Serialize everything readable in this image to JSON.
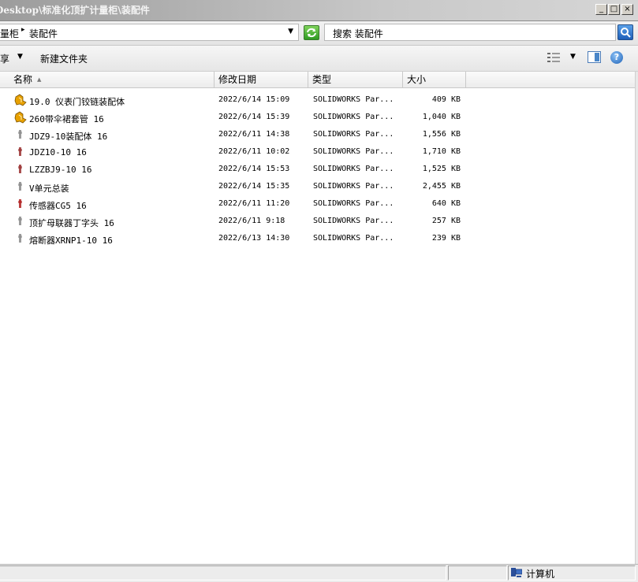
{
  "window": {
    "title": "Desktop\\标准化顶扩计量柜\\装配件",
    "minimize_label": "_",
    "maximize_label": "□",
    "close_label": "×"
  },
  "address": {
    "crumbs": [
      "量柜",
      "装配件"
    ],
    "separator": "▸",
    "dropdown": "▼"
  },
  "search": {
    "placeholder": "搜索 装配件"
  },
  "toolbar": {
    "share_label": "享",
    "share_dropdown": "▼",
    "new_folder_label": "新建文件夹",
    "view_dropdown": "▼",
    "help_label": "?"
  },
  "columns": {
    "name": "名称",
    "date": "修改日期",
    "type": "类型",
    "size": "大小",
    "sort_indicator": "▲"
  },
  "files": [
    {
      "name": "19.0 仪表门铰链装配体",
      "date": "2022/6/14 15:09",
      "type": "SOLIDWORKS Par...",
      "size": "409 KB",
      "icon": "assembly-icon"
    },
    {
      "name": "260带伞裙套管 16",
      "date": "2022/6/14 15:39",
      "type": "SOLIDWORKS Par...",
      "size": "1,040 KB",
      "icon": "assembly-icon"
    },
    {
      "name": "JDZ9-10装配体 16",
      "date": "2022/6/11 14:38",
      "type": "SOLIDWORKS Par...",
      "size": "1,556 KB",
      "icon": "part-thumbnail-icon"
    },
    {
      "name": "JDZ10-10 16",
      "date": "2022/6/11 10:02",
      "type": "SOLIDWORKS Par...",
      "size": "1,710 KB",
      "icon": "part-thumbnail-icon"
    },
    {
      "name": "LZZBJ9-10 16",
      "date": "2022/6/14 15:53",
      "type": "SOLIDWORKS Par...",
      "size": "1,525 KB",
      "icon": "part-thumbnail-icon"
    },
    {
      "name": "V单元总装",
      "date": "2022/6/14 15:35",
      "type": "SOLIDWORKS Par...",
      "size": "2,455 KB",
      "icon": "part-thumbnail-icon"
    },
    {
      "name": "传感器CG5 16",
      "date": "2022/6/11 11:20",
      "type": "SOLIDWORKS Par...",
      "size": "640 KB",
      "icon": "part-thumbnail-icon"
    },
    {
      "name": "顶扩母联器丁字头 16",
      "date": "2022/6/11 9:18",
      "type": "SOLIDWORKS Par...",
      "size": "257 KB",
      "icon": "part-thumbnail-icon"
    },
    {
      "name": "熔断器XRNP1-10 16",
      "date": "2022/6/13 14:30",
      "type": "SOLIDWORKS Par...",
      "size": "239 KB",
      "icon": "part-thumbnail-icon"
    }
  ],
  "statusbar": {
    "location_label": "计算机"
  },
  "colors": {
    "assembly_icon": "#e8a100",
    "part_icon_gray": "#8a8a8a",
    "part_icon_red": "#b02020",
    "refresh_green": "#2f9a22",
    "search_blue": "#1e5fb8"
  }
}
